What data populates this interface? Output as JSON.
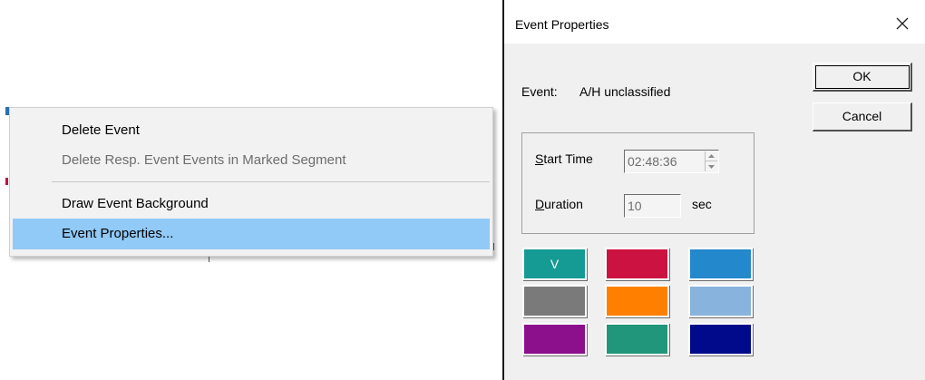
{
  "context_menu": {
    "items": [
      {
        "label": "Delete Event",
        "state": "enabled"
      },
      {
        "label": "Delete Resp. Event Events in Marked Segment",
        "state": "disabled"
      },
      {
        "label": "Draw Event Background",
        "state": "enabled"
      },
      {
        "label": "Event Properties...",
        "state": "highlighted"
      }
    ],
    "highlight_color": "#91c9f7"
  },
  "dialog": {
    "title": "Event Properties",
    "close_icon": "close-icon",
    "event_label": "Event:",
    "event_value": "A/H unclassified",
    "ok_label": "OK",
    "cancel_label": "Cancel",
    "start_time": {
      "mnemonic": "S",
      "rest": "tart Time",
      "value": "02:48:36"
    },
    "duration": {
      "mnemonic": "D",
      "rest": "uration",
      "value": "10",
      "unit": "sec"
    },
    "colors": [
      {
        "name": "teal",
        "hex": "#169a94",
        "label": "V",
        "selected": true
      },
      {
        "name": "crimson",
        "hex": "#cc1241",
        "label": ""
      },
      {
        "name": "blue",
        "hex": "#2488cc",
        "label": ""
      },
      {
        "name": "gray",
        "hex": "#7a7a7a",
        "label": ""
      },
      {
        "name": "orange",
        "hex": "#ff8000",
        "label": ""
      },
      {
        "name": "light-blue",
        "hex": "#88b3dc",
        "label": ""
      },
      {
        "name": "purple",
        "hex": "#8c0f8c",
        "label": ""
      },
      {
        "name": "sea-green",
        "hex": "#21967a",
        "label": ""
      },
      {
        "name": "navy",
        "hex": "#000a8a",
        "label": ""
      }
    ]
  }
}
